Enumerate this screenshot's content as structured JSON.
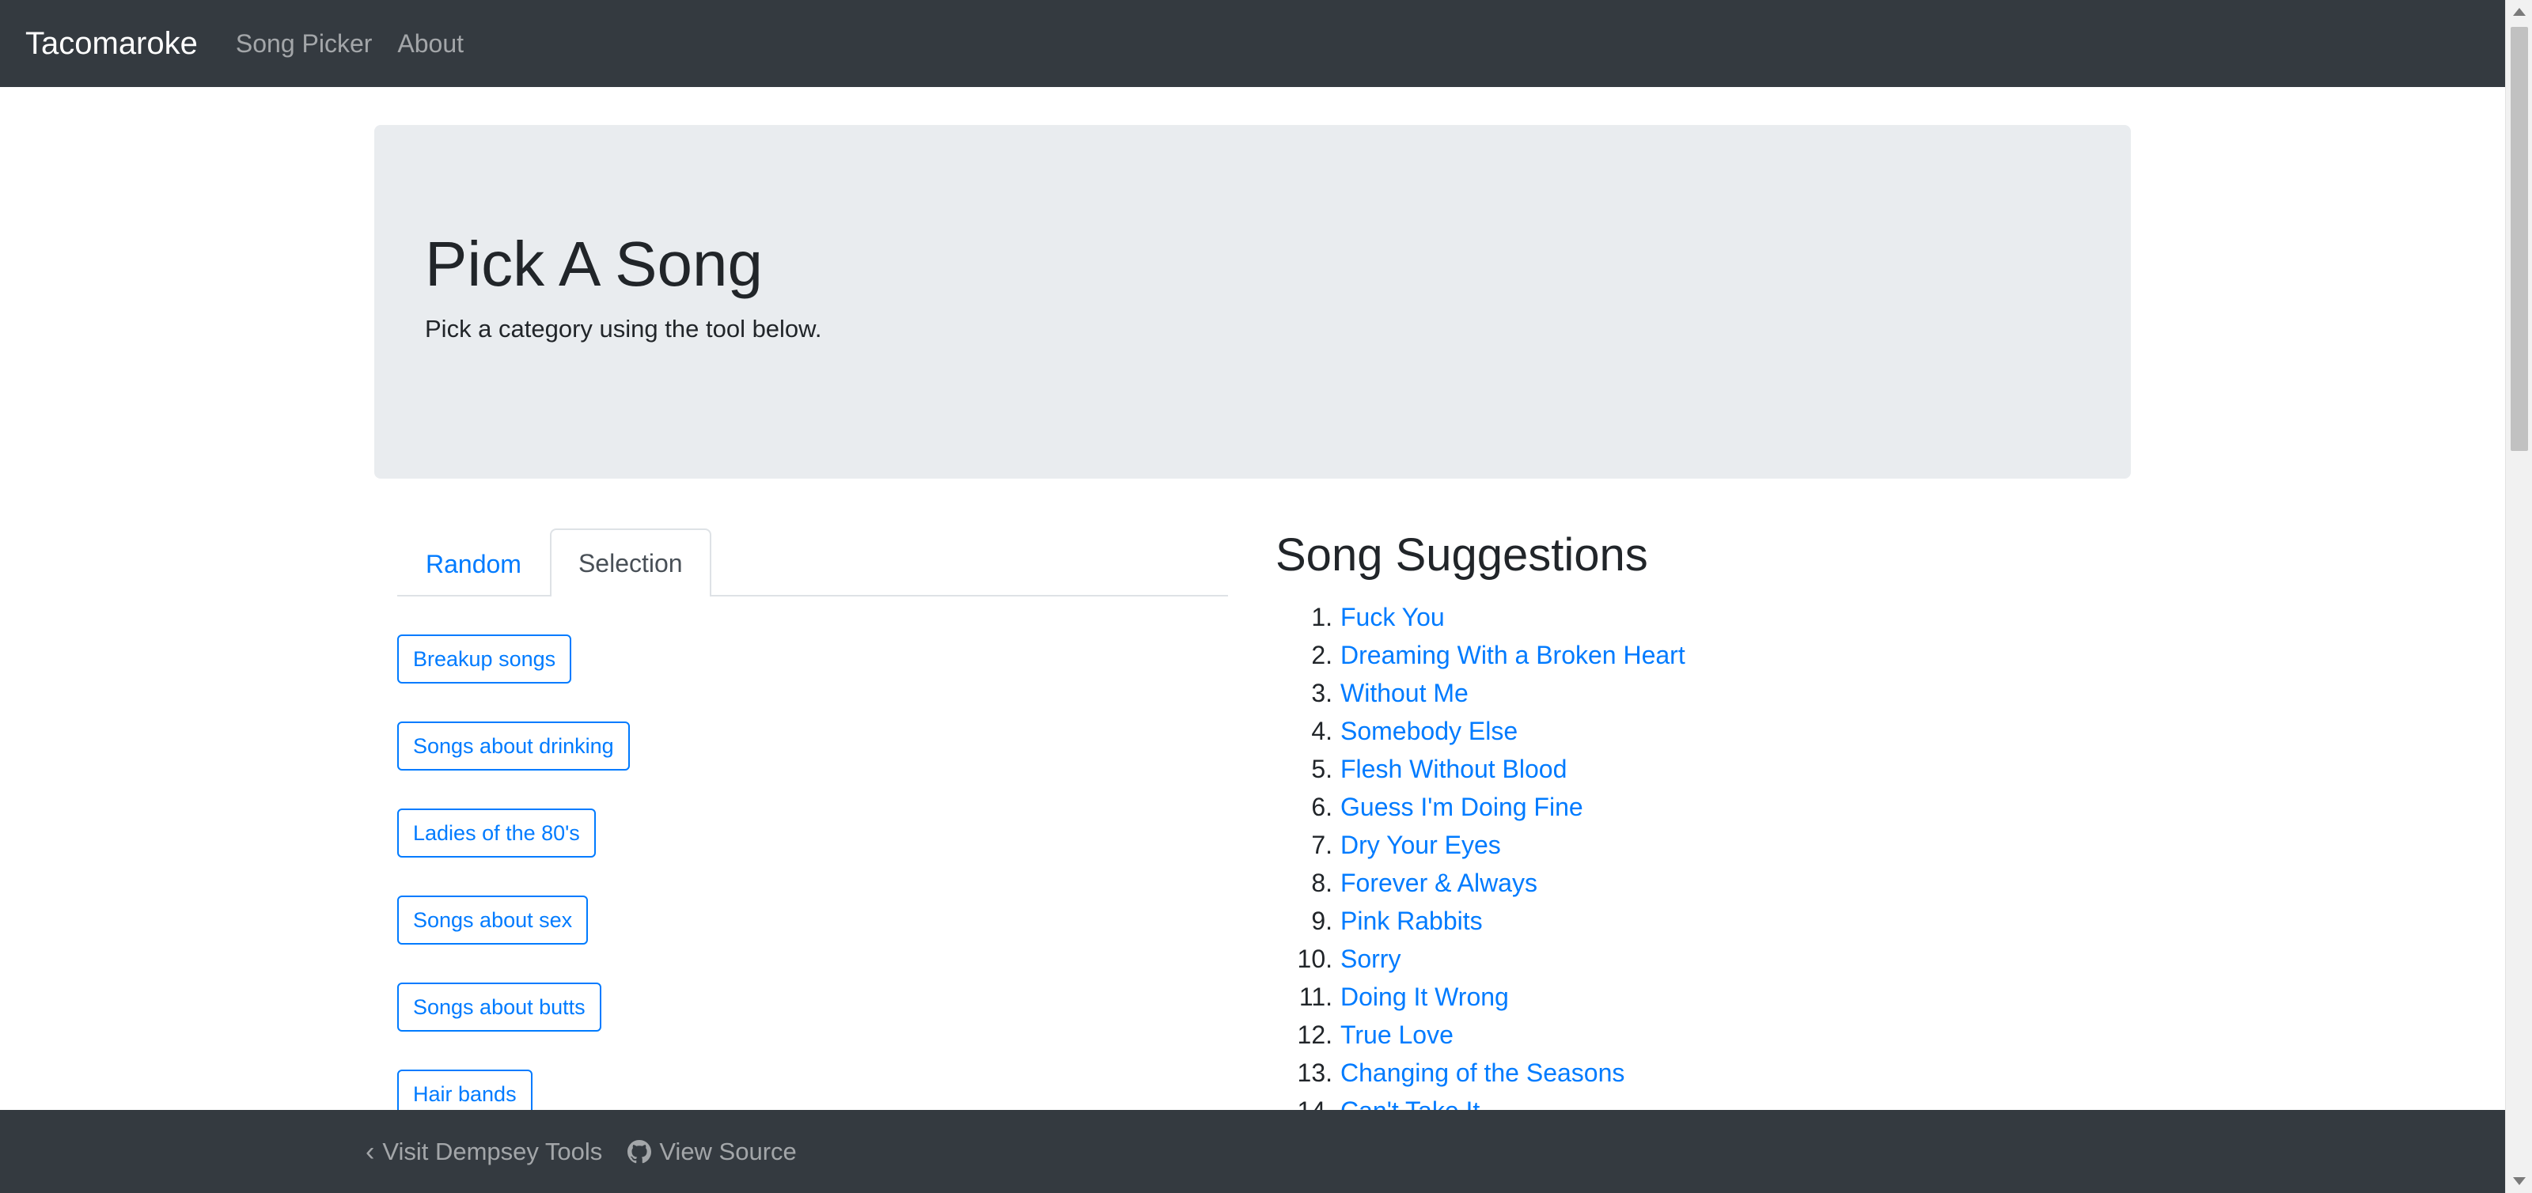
{
  "nav": {
    "brand": "Tacomaroke",
    "links": [
      "Song Picker",
      "About"
    ]
  },
  "jumbotron": {
    "title": "Pick A Song",
    "subtitle": "Pick a category using the tool below."
  },
  "tabs": [
    {
      "label": "Random",
      "active": false
    },
    {
      "label": "Selection",
      "active": true
    }
  ],
  "categories": [
    "Breakup songs",
    "Songs about drinking",
    "Ladies of the 80's",
    "Songs about sex",
    "Songs about butts",
    "Hair bands"
  ],
  "suggestions": {
    "title": "Song Suggestions",
    "songs": [
      "Fuck You",
      "Dreaming With a Broken Heart",
      "Without Me",
      "Somebody Else",
      "Flesh Without Blood",
      "Guess I'm Doing Fine",
      "Dry Your Eyes",
      "Forever & Always",
      "Pink Rabbits",
      "Sorry",
      "Doing It Wrong",
      "True Love",
      "Changing of the Seasons",
      "Can't Take It"
    ]
  },
  "footer": {
    "visit": "Visit Dempsey Tools",
    "source": "View Source"
  },
  "colors": {
    "navbar": "#343a40",
    "link": "#007bff",
    "jumbotron": "#e9ecef"
  }
}
